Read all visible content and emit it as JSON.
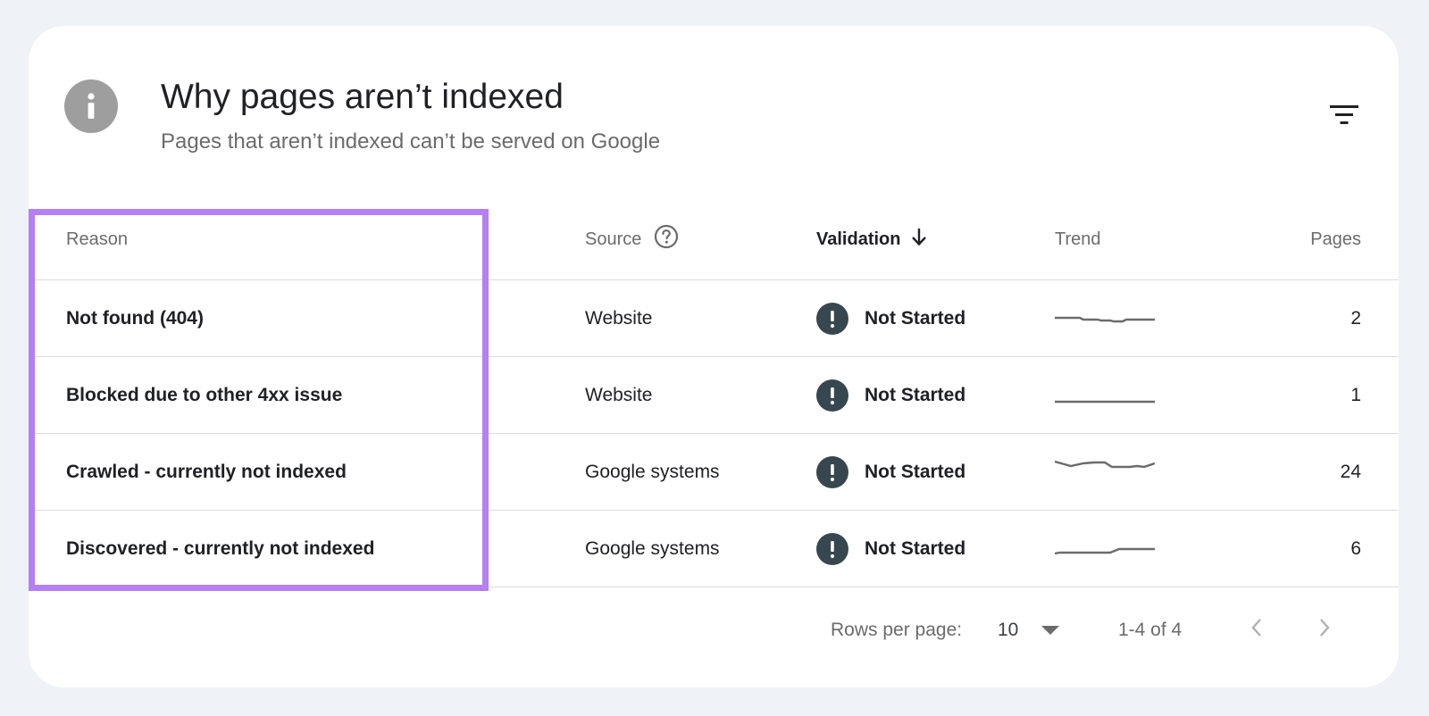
{
  "header": {
    "title": "Why pages aren’t indexed",
    "subtitle": "Pages that aren’t indexed can’t be served on Google",
    "info_icon": "info-icon",
    "filter_icon": "filter-icon"
  },
  "table": {
    "columns": {
      "reason": "Reason",
      "source": "Source",
      "validation": "Validation",
      "trend": "Trend",
      "pages": "Pages"
    },
    "rows": [
      {
        "reason": "Not found (404)",
        "source": "Website",
        "validation": "Not Started",
        "pages": "2"
      },
      {
        "reason": "Blocked due to other 4xx issue",
        "source": "Website",
        "validation": "Not Started",
        "pages": "1"
      },
      {
        "reason": "Crawled - currently not indexed",
        "source": "Google systems",
        "validation": "Not Started",
        "pages": "24"
      },
      {
        "reason": "Discovered - currently not indexed",
        "source": "Google systems",
        "validation": "Not Started",
        "pages": "6"
      }
    ]
  },
  "pagination": {
    "rows_per_page_label": "Rows per page:",
    "rows_per_page_value": "10",
    "range": "1-4 of 4"
  },
  "colors": {
    "highlight": "#b57ff5",
    "warning_icon": "#37474f",
    "info_icon": "#9e9e9e"
  }
}
